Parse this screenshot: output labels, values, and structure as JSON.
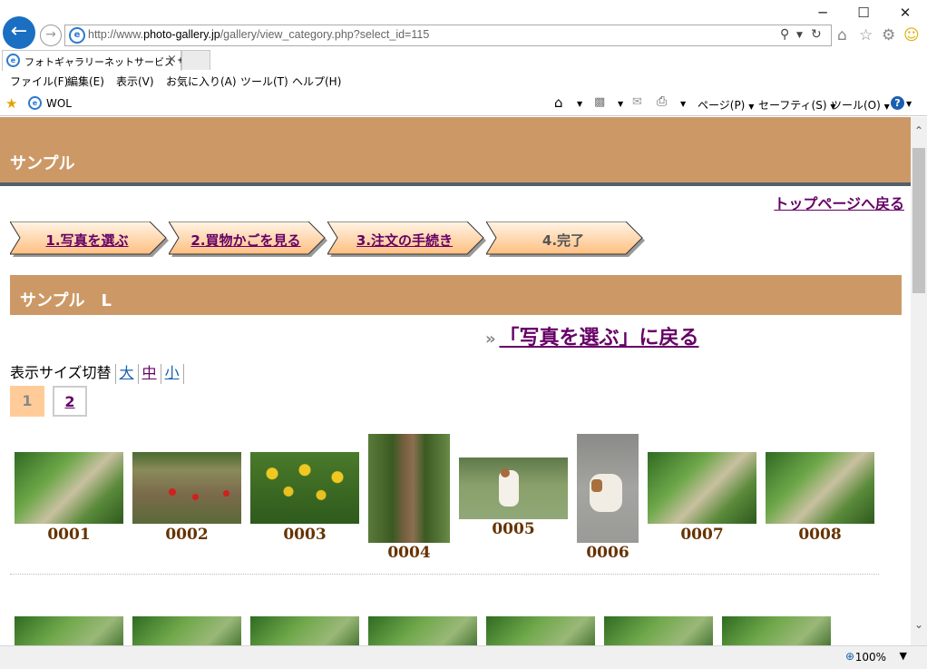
{
  "browser": {
    "url_prefix": "http://www.",
    "url_host": "photo-gallery.jp",
    "url_path": "/gallery/view_category.php?select_id=115",
    "tab_title": "フォトギャラリーネットサービス サ...",
    "tab_close": "×",
    "menu": [
      "ファイル(F)",
      "編集(E)",
      "表示(V)",
      "お気に入り(A)",
      "ツール(T)",
      "ヘルプ(H)"
    ],
    "favorites_item": "WOL",
    "commands": {
      "page": "ページ(P)",
      "safety": "セーフティ(S)",
      "tools": "ツール(O)"
    },
    "window_controls": {
      "minimize": "─",
      "maximize": "☐",
      "close": "✕"
    },
    "zoom": "100%"
  },
  "page": {
    "site_title": "サンプル",
    "top_link": "トップページへ戻る",
    "steps": [
      {
        "label": "1.写真を選ぶ",
        "current": false
      },
      {
        "label": "2.買物かごを見る",
        "current": false
      },
      {
        "label": "3.注文の手続き",
        "current": false
      },
      {
        "label": "4.完了",
        "current": true
      }
    ],
    "category_title": "サンプル　L",
    "back_arrow": "»",
    "back_link": "「写真を選ぶ」に戻る",
    "size_switch": {
      "label": "表示サイズ切替",
      "options": [
        "大",
        "中",
        "小"
      ]
    },
    "pagination": [
      "1",
      "2"
    ],
    "photos_row1": [
      {
        "id": "0001",
        "subject": "stone stairs in forest"
      },
      {
        "id": "0002",
        "subject": "children playing on field"
      },
      {
        "id": "0003",
        "subject": "sunflower field"
      },
      {
        "id": "0004",
        "subject": "palm tree trunk"
      },
      {
        "id": "0005",
        "subject": "jack russell terrier on lawn"
      },
      {
        "id": "0006",
        "subject": "jack russell terrier lying"
      },
      {
        "id": "0007",
        "subject": "stone stairs in forest"
      },
      {
        "id": "0008",
        "subject": "stone stairs in forest"
      }
    ]
  },
  "colors": {
    "header": "#cc9966",
    "step_fill_top": "#fff2e0",
    "step_fill_bottom": "#ffc080",
    "link": "#660066",
    "photo_label": "#663300",
    "ie_blue": "#1a6fc2"
  }
}
